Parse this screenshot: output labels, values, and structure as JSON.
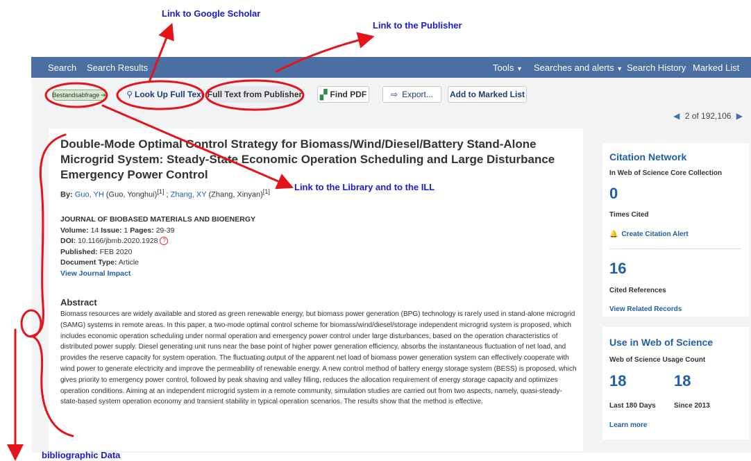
{
  "annotations": {
    "google_scholar": "Link to Google Scholar",
    "publisher": "Link to the Publisher",
    "library": "Link to the Library and to the ILL",
    "bibliographic": "bibliographic Data"
  },
  "nav": {
    "search": "Search",
    "search_results": "Search Results",
    "tools": "Tools",
    "searches_alerts": "Searches and alerts",
    "search_history": "Search History",
    "marked_list": "Marked List"
  },
  "toolbar": {
    "bestand": "Bestandsabfrage",
    "lookup": "Look Up Full Text",
    "publisher": "Full Text from Publisher",
    "findpdf": "Find PDF",
    "export": "Export...",
    "marked": "Add to Marked List"
  },
  "pager": {
    "text": "2 of 192,106"
  },
  "record": {
    "title": "Double-Mode Optimal Control Strategy for Biomass/Wind/Diesel/Battery Stand-Alone Microgrid System: Steady-State Economic Operation Scheduling and Large Disturbance Emergency Power Control",
    "by_label": "By:",
    "author1_link": "Guo, YH",
    "author1_full": "(Guo, Yonghui)",
    "author_sup": "[1]",
    "sep": ";",
    "author2_link": "Zhang, XY",
    "author2_full": "(Zhang, Xinyan)",
    "journal": "JOURNAL OF BIOBASED MATERIALS AND BIOENERGY",
    "volume_label": "Volume:",
    "volume": "14",
    "issue_label": "Issue:",
    "issue": "1",
    "pages_label": "Pages:",
    "pages": "29-39",
    "doi_label": "DOI:",
    "doi": "10.1166/jbmb.2020.1928",
    "published_label": "Published:",
    "published": "FEB 2020",
    "doctype_label": "Document Type:",
    "doctype": "Article",
    "journal_impact": "View Journal Impact",
    "abstract_heading": "Abstract",
    "abstract": "Biomass resources are widely available and stored as green renewable energy, but biomass power generation (BPG) technology is rarely used in stand-alone microgrid (SAMG) systems in remote areas. In this paper, a two-mode optimal control scheme for biomass/wind/diesel/storage independent microgrid system is proposed, which includes economic operation scheduling under normal operation and emergency power control under large disturbances, based on the operation characteristics of distributed power supply. Diesel generating unit runs near the base point of higher power generation efficiency, absorbs the instantaneous fluctuation of net load, and provides the reserve capacity for system operation. The fluctuating output of the apparent net load of biomass power generation system can effectively cooperate with wind power to generate electricity and improve the permeability of renewable energy. A new control method of battery energy storage system (BESS) is proposed, which gives priority to emergency power control, followed by peak shaving and valley filling, reduces the allocation requirement of energy storage capacity and optimizes operation conditions. Aiming at an independent microgrid system in a remote community, simulation studies are carried out from two aspects, namely, quasi-steady-state-based system operation economy and transient stability in typical operation scenarios. The results show that the method is effective."
  },
  "citation_network": {
    "heading": "Citation Network",
    "sub": "In Web of Science Core Collection",
    "times_cited": "0",
    "times_cited_label": "Times Cited",
    "create_alert": "Create Citation Alert",
    "cited_refs": "16",
    "cited_refs_label": "Cited References",
    "related": "View Related Records"
  },
  "usage": {
    "heading": "Use in Web of Science",
    "sub": "Web of Science Usage Count",
    "count180": "18",
    "count2013": "18",
    "label180": "Last 180 Days",
    "label2013": "Since 2013",
    "learn": "Learn more"
  },
  "colors": {
    "nav_bg": "#4b6ea3",
    "link": "#1f5ea8",
    "annotation_red": "#e5141a",
    "annotation_blue": "#1a1ad6"
  }
}
